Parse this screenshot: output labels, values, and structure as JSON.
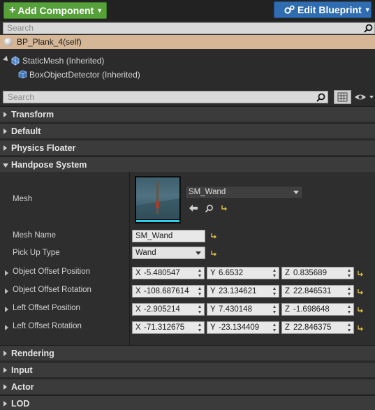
{
  "toolbar": {
    "add_component_label": "Add Component",
    "edit_blueprint_label": "Edit Blueprint"
  },
  "components": {
    "search_placeholder": "Search",
    "self_item": "BP_Plank_4(self)",
    "tree": [
      {
        "label": "StaticMesh (Inherited)"
      },
      {
        "label": "BoxObjectDetector (Inherited)"
      }
    ]
  },
  "details": {
    "search_placeholder": "Search",
    "categories_collapsed_top": [
      "Transform",
      "Default",
      "Physics Floater"
    ],
    "open_category": "Handpose System",
    "categories_collapsed_bottom": [
      "Rendering",
      "Input",
      "Actor",
      "LOD"
    ],
    "mesh": {
      "label": "Mesh",
      "asset": "SM_Wand"
    },
    "mesh_name": {
      "label": "Mesh Name",
      "value": "SM_Wand"
    },
    "pick_up_type": {
      "label": "Pick Up Type",
      "value": "Wand"
    },
    "vectors": [
      {
        "label": "Object Offset Position",
        "x": "-5.480547",
        "y": "6.6532",
        "z": "0.835689"
      },
      {
        "label": "Object Offset Rotation",
        "x": "-108.687614",
        "y": "23.134621",
        "z": "22.846531"
      },
      {
        "label": "Left Offset Position",
        "x": "-2.905214",
        "y": "7.430148",
        "z": "-1.698648"
      },
      {
        "label": "Left Offset Rotation",
        "x": "-71.312675",
        "y": "-23.134409",
        "z": "22.846375"
      }
    ],
    "axis_letters": {
      "x": "X",
      "y": "Y",
      "z": "Z"
    }
  },
  "colors": {
    "add_button": "#57a13b",
    "edit_button": "#2f6cb0",
    "self_row": "#d5b696",
    "thumbnail_bar": "#2ad0ea",
    "reset_arrow": "#e0c040"
  }
}
